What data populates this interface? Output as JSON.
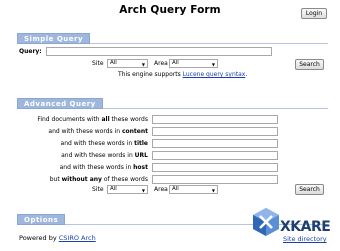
{
  "page": {
    "title": "Arch Query Form",
    "login_label": "Login"
  },
  "simple": {
    "heading": "Simple Query",
    "query_label": "Query:",
    "site_label": "Site",
    "site_value": "All",
    "area_label": "Area",
    "area_value": "All",
    "search_label": "Search",
    "note_prefix": "This engine supports ",
    "note_link": "Lucene query syntax",
    "note_suffix": "."
  },
  "advanced": {
    "heading": "Advanced Query",
    "rows": [
      {
        "pre": "Find documents with ",
        "bold": "all",
        "post": " these words"
      },
      {
        "pre": "and with these words in ",
        "bold": "content",
        "post": ""
      },
      {
        "pre": "and with these words in ",
        "bold": "title",
        "post": ""
      },
      {
        "pre": "and with these words in ",
        "bold": "URL",
        "post": ""
      },
      {
        "pre": "and with these words in ",
        "bold": "host",
        "post": ""
      },
      {
        "pre": "but ",
        "bold": "without any",
        "post": " of these words"
      }
    ],
    "site_label": "Site",
    "site_value": "All",
    "area_label": "Area",
    "area_value": "All",
    "search_label": "Search"
  },
  "options": {
    "heading": "Options"
  },
  "footer": {
    "powered_prefix": "Powered by ",
    "powered_link": "CSIRO Arch",
    "logo_text": "XKARE",
    "site_directory": "Site directory"
  },
  "colors": {
    "section_tab": "#9fb7dd",
    "link": "#1a3fb0",
    "logo": "#1f5fa8"
  }
}
